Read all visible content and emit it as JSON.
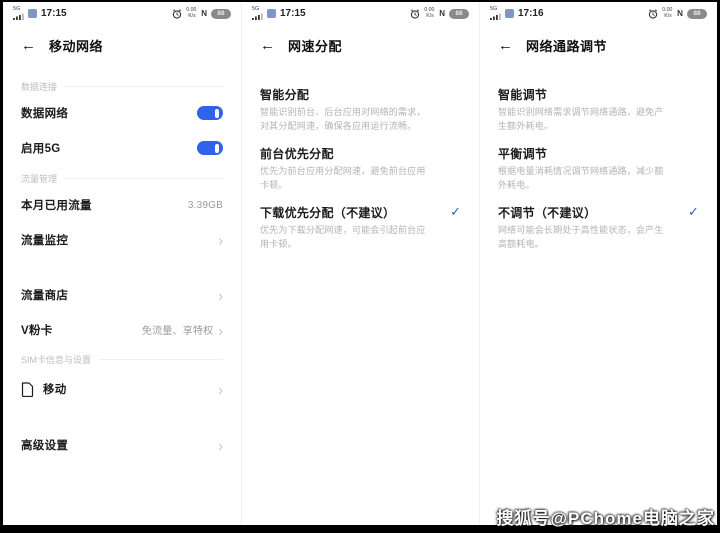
{
  "watermark": "搜狐号@PChome电脑之家",
  "colors": {
    "toggle_blue": "#2f63ea",
    "check_blue": "#2e5ad0"
  },
  "check_glyph": "✓",
  "chevron_glyph": "›",
  "back_glyph": "←",
  "status_common": {
    "signal_label": "5G",
    "net_speed_value": "0.00",
    "net_speed_unit": "K/s",
    "nfc_label": "N",
    "battery_percent": "88"
  },
  "panel_mobile": {
    "status_time": "17:15",
    "title": "移动网络",
    "section_data_connection": "数据连接",
    "row_data_network": "数据网络",
    "row_enable_5g": "启用5G",
    "section_data_management": "流量管理",
    "row_month_usage_label": "本月已用流量",
    "row_month_usage_value": "3.39GB",
    "row_data_monitor": "流量监控",
    "row_data_store": "流量商店",
    "row_vcard_label": "V粉卡",
    "row_vcard_value": "免流量、享特权",
    "section_sim": "SIM卡信息与设置",
    "row_sim_mobile": "移动",
    "row_advanced": "高级设置"
  },
  "panel_speed": {
    "status_time": "17:15",
    "title": "网速分配",
    "options": [
      {
        "title": "智能分配",
        "desc": "智能识别前台、后台应用对网络的需求，对其分配网速，确保各应用运行流畅。",
        "selected": false
      },
      {
        "title": "前台优先分配",
        "desc": "优先为前台应用分配网速，避免前台应用卡顿。",
        "selected": false
      },
      {
        "title": "下载优先分配（不建议）",
        "desc": "优先为下载分配网速，可能会引起前台应用卡顿。",
        "selected": true
      }
    ]
  },
  "panel_path": {
    "status_time": "17:16",
    "title": "网络通路调节",
    "options": [
      {
        "title": "智能调节",
        "desc": "智能识别网络需求调节网络通路，避免产生额外耗电。",
        "selected": false
      },
      {
        "title": "平衡调节",
        "desc": "根据电量消耗情况调节网络通路，减少额外耗电。",
        "selected": false
      },
      {
        "title": "不调节（不建议）",
        "desc": "网络可能会长期处于高性能状态，会产生高额耗电。",
        "selected": true
      }
    ]
  }
}
